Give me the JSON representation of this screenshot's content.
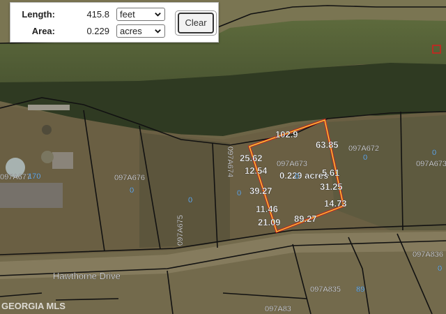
{
  "measure_panel": {
    "length_label": "Length:",
    "length_value": "415.8",
    "length_unit": "feet",
    "area_label": "Area:",
    "area_value": "0.229",
    "area_unit": "acres",
    "clear_label": "Clear"
  },
  "segment_labels": [
    "102.9",
    "63.85",
    "25.62",
    "12.54",
    "0.229 acres",
    "5.61",
    "39.27",
    "31.25",
    "14.73",
    "11.46",
    "21.09",
    "89.27"
  ],
  "parcel_labels": {
    "p1": "097A672",
    "p2": "097A673",
    "p3": "097A674",
    "p4": "097A675",
    "p5": "097A676",
    "p6": "097A677",
    "p7": "097A673",
    "p8": "097A836",
    "p9": "097A835",
    "p10": "097A83"
  },
  "parcel_values": {
    "v1": "0",
    "v2": "0",
    "v3": "0",
    "v4": "0",
    "v5": "0",
    "v6": "0",
    "v7": "170",
    "v8": "0",
    "v9": "89"
  },
  "street_label": "Hawthorne Drive",
  "watermark": "GEORGIA MLS",
  "colors": {
    "measure_outline": "#d71d1d",
    "measure_inner": "#f3e63c",
    "parcel_line": "#111111"
  }
}
